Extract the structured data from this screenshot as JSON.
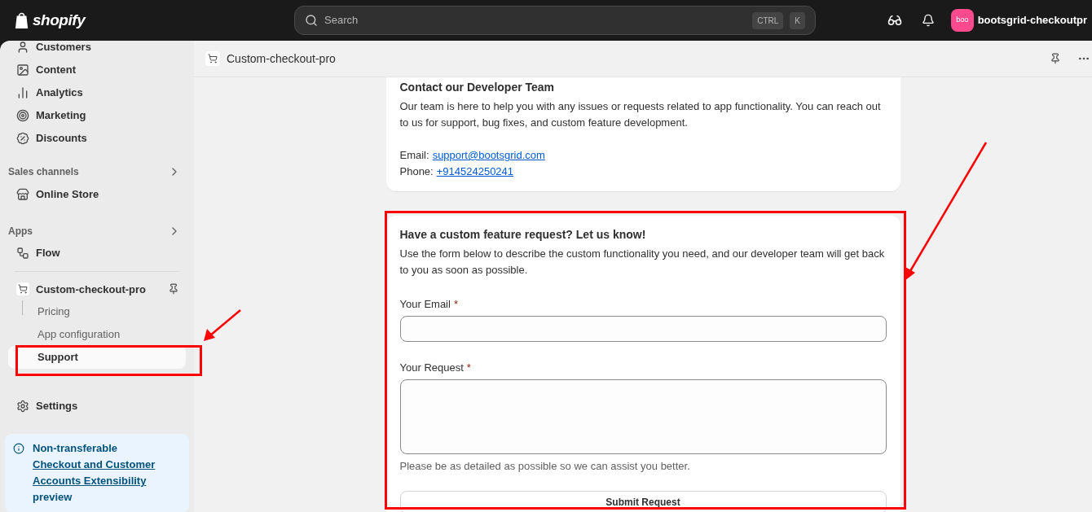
{
  "topbar": {
    "logo": "shopify",
    "search": {
      "placeholder": "Search",
      "keys": [
        "CTRL",
        "K"
      ]
    },
    "store": {
      "avatar": "boo",
      "name": "bootsgrid-checkoutpr"
    }
  },
  "sidebar": {
    "nav": [
      {
        "label": "Customers"
      },
      {
        "label": "Content"
      },
      {
        "label": "Analytics"
      },
      {
        "label": "Marketing"
      },
      {
        "label": "Discounts"
      }
    ],
    "sales_channels": {
      "heading": "Sales channels",
      "items": [
        {
          "label": "Online Store"
        }
      ]
    },
    "apps": {
      "heading": "Apps",
      "items": [
        {
          "label": "Flow"
        }
      ]
    },
    "app": {
      "name": "Custom-checkout-pro",
      "children": [
        {
          "label": "Pricing",
          "selected": false
        },
        {
          "label": "App configuration",
          "selected": false
        },
        {
          "label": "Support",
          "selected": true
        }
      ]
    },
    "settings": "Settings",
    "notice": {
      "lead": "Non-transferable",
      "link": "Checkout and Customer Accounts Extensibility",
      "tail": "preview"
    }
  },
  "page": {
    "title": "Custom-checkout-pro",
    "contact": {
      "heading": "Contact our Developer Team",
      "body": "Our team is here to help you with any issues or requests related to app functionality. You can reach out to us for support, bug fixes, and custom feature development.",
      "email_label": "Email:",
      "email": "support@bootsgrid.com",
      "phone_label": "Phone:",
      "phone": "+914524250241"
    },
    "form": {
      "heading": "Have a custom feature request? Let us know!",
      "body": "Use the form below to describe the custom functionality you need, and our developer team will get back to you as soon as possible.",
      "fields": [
        {
          "kind": "input",
          "label": "Your Email",
          "required_mark": "*"
        },
        {
          "kind": "textarea",
          "label": "Your Request",
          "required_mark": "*",
          "help": "Please be as detailed as possible so we can assist you better."
        }
      ],
      "submit": "Submit Request"
    }
  }
}
